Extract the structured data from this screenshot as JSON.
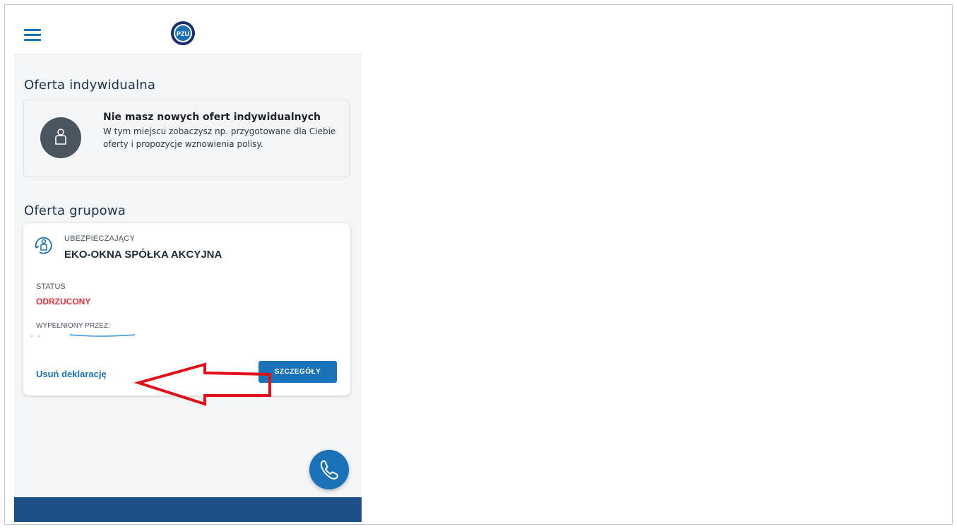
{
  "header": {
    "menu_icon": "hamburger-menu-icon",
    "logo_text": "PZU"
  },
  "individual": {
    "title": "Oferta indywidualna",
    "card": {
      "icon": "person-icon",
      "heading": "Nie masz nowych ofert indywidualnych",
      "body": "W tym miejscu zobaczysz np. przygotowane dla Ciebie oferty i propozycje wznowienia polisy."
    }
  },
  "group": {
    "title": "Oferta grupowa",
    "card": {
      "icon": "insurer-person-icon",
      "insurer_label": "UBEZPIECZAJĄCY",
      "insurer_name": "EKO-OKNA SPÓŁKA AKCYJNA",
      "status_label": "STATUS",
      "status_value": "ODRZUCONY",
      "filled_by_label": "WYPEŁNIONY PRZEZ:",
      "remove_link": "Usuń deklarację",
      "details_button": "SZCZEGÓŁY"
    }
  },
  "fab": {
    "icon": "phone-icon"
  },
  "colors": {
    "primary": "#1a72b8",
    "status_rejected": "#e8323c",
    "bottom_bar": "#1b4f86",
    "annotation": "#e3101a"
  }
}
